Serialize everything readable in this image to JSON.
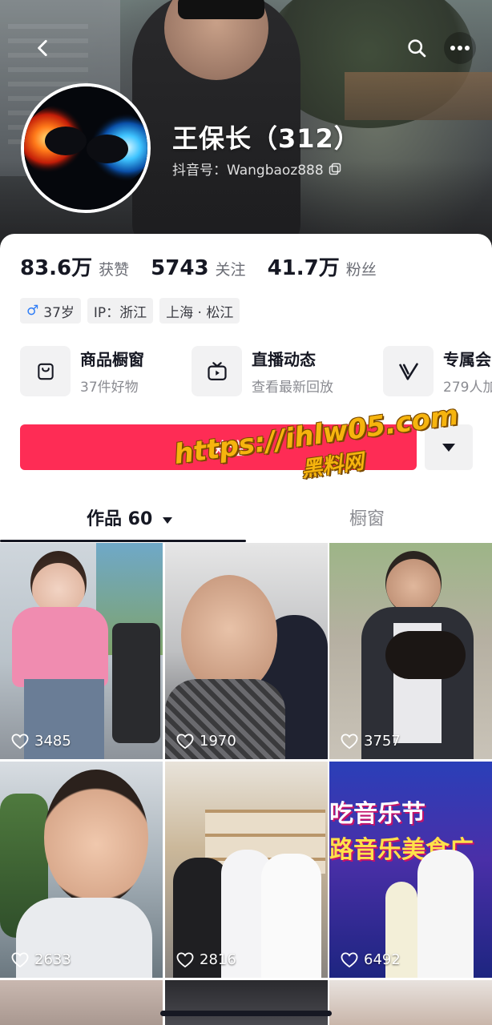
{
  "header": {
    "back_icon": "chevron-left-icon",
    "search_icon": "search-icon",
    "more_icon": "more-horizontal-icon"
  },
  "profile": {
    "name": "王保长（312）",
    "douyin_id": "抖音号：Wangbaoz888",
    "copy_icon": "copy-icon"
  },
  "stats": [
    {
      "value": "83.6万",
      "label": "获赞"
    },
    {
      "value": "5743",
      "label": "关注"
    },
    {
      "value": "41.7万",
      "label": "粉丝"
    }
  ],
  "tags": {
    "gender_age": "37岁",
    "ip": "IP：浙江",
    "location": "上海 · 松江"
  },
  "services": [
    {
      "title": "商品橱窗",
      "subtitle": "37件好物",
      "icon": "shopping-bag-icon"
    },
    {
      "title": "直播动态",
      "subtitle": "查看最新回放",
      "icon": "tv-icon"
    },
    {
      "title": "专属会",
      "subtitle": "279人加",
      "icon": "v-badge-icon"
    }
  ],
  "actions": {
    "follow_label": "＋关注",
    "more_icon": "caret-down-icon"
  },
  "watermark": {
    "url": "https://ihlw05.com",
    "sub": "黑料网"
  },
  "tabs": {
    "works": "作品 60",
    "showcase": "橱窗"
  },
  "videos": [
    {
      "likes": "3485"
    },
    {
      "likes": "1970"
    },
    {
      "likes": "3757"
    },
    {
      "likes": "2633"
    },
    {
      "likes": "2816"
    },
    {
      "likes": "6492"
    }
  ],
  "video6_overlay": {
    "line1": "吃音乐节",
    "line2": "路音乐美食广"
  },
  "colors": {
    "accent": "#fe2c55",
    "text": "#161823",
    "muted": "#8a8b91"
  }
}
